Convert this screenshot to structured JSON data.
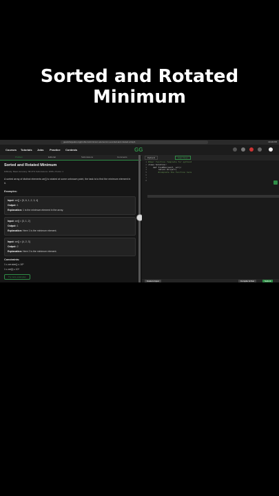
{
  "video_title": "Sorted and Rotated Minimum",
  "browser": {
    "url": "geeksforgeeks.org/problems/minimum-element-in-a-sorted-and-rotated-array/1",
    "clock": "10:49 PM"
  },
  "nav": {
    "items": [
      "Courses",
      "Tutorials",
      "Jobs",
      "Practice",
      "Contests"
    ],
    "logo": "GG"
  },
  "tabs": [
    "Problem",
    "Editorial",
    "Submissions",
    "Comments"
  ],
  "problem": {
    "title": "Sorted and Rotated Minimum",
    "meta": "Difficulty: Basic    Accuracy: 58.47%    Submissions: 100K+    Points: 1",
    "description": "A sorted array of distinct elements arr[] is rotated at some unknown point, the task is to find the minimum element in it.",
    "examples_heading": "Examples:",
    "examples": [
      {
        "input": "arr[] = [5, 6, 1, 2, 3, 4]",
        "output": "1",
        "explanation": "1 is the minimum element in the array."
      },
      {
        "input": "arr[] = [3, 1, 2]",
        "output": "1",
        "explanation": "Here 1 is the minimum element."
      },
      {
        "input": "arr[] = [4, 2, 3]",
        "output": "2",
        "explanation": "Here 2 is the minimum element."
      }
    ],
    "labels": {
      "input": "Input:",
      "output": "Output:",
      "explanation": "Explanation:"
    },
    "constraints_heading": "Constraints:",
    "constraints": [
      "1 ≤ arr.size() ≤ 10⁵",
      "1 ≤ arr[i] ≤ 10⁹"
    ],
    "tags_button": "Try more examples"
  },
  "editor": {
    "language": "Python3",
    "start_timer": "Start Timer",
    "line_numbers": [
      "1",
      "2",
      "3",
      "4",
      "5",
      "6",
      "7",
      "8"
    ],
    "code_lines": [
      "#User function Template for python3",
      "",
      "class Solution:",
      "    def findMin(self, arr):",
      "        return min(arr)",
      "        #complete the function here",
      "",
      ""
    ],
    "buttons": [
      "Custom Input",
      "Compile & Run",
      "Submit"
    ]
  },
  "colors": {
    "brand": "#2f8d46",
    "background": "#000000"
  }
}
